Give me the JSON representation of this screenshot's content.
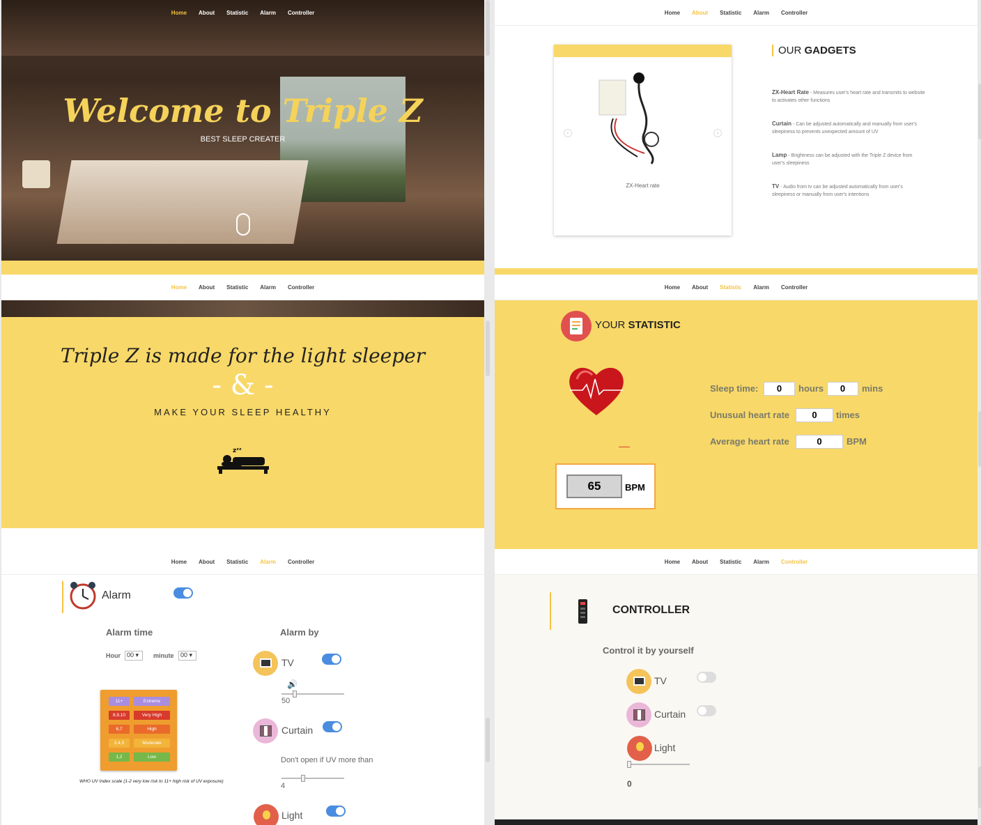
{
  "nav": [
    "Home",
    "About",
    "Statistic",
    "Alarm",
    "Controller"
  ],
  "hero": {
    "title": "Welcome to Triple Z",
    "subtitle": "BEST SLEEP CREATER"
  },
  "gadgets": {
    "heading_light": "OUR",
    "heading_bold": "GADGETS",
    "card_caption": "ZX-Heart rate",
    "items": [
      {
        "name": "ZX-Heart Rate",
        "desc": " - Measures user's heart rate and transmits to website to activates other functions"
      },
      {
        "name": "Curtain",
        "desc": " - Can be adjusted automatically and manually from user's sleepiness to prevents unexpected amount of UV"
      },
      {
        "name": "Lamp",
        "desc": " - Brightness can be adjusted with the Triple Z device from user's sleepiness"
      },
      {
        "name": "TV",
        "desc": " - Audio from tv can be adjusted automatically from user's sleepiness or manually from user's intentions"
      }
    ]
  },
  "intro": {
    "title": "Triple Z is made for the light sleeper",
    "amp": "- & -",
    "subtitle": "MAKE YOUR SLEEP HEALTHY"
  },
  "statistic": {
    "heading_light": "YOUR",
    "heading_bold": "STATISTIC",
    "sleep_label": "Sleep time:",
    "sleep_hours": "0",
    "hours_unit": "hours",
    "sleep_mins": "0",
    "mins_unit": "mins",
    "unusual_label": "Unusual heart rate",
    "unusual_value": "0",
    "unusual_unit": "times",
    "avg_label": "Average heart rate",
    "avg_value": "0",
    "avg_unit": "BPM",
    "bpm_value": "65",
    "bpm_unit": "BPM"
  },
  "alarm": {
    "title": "Alarm",
    "time_heading": "Alarm time",
    "hour_label": "Hour",
    "hour_value": "00",
    "minute_label": "minute",
    "minute_value": "00",
    "by_heading": "Alarm by",
    "tv_label": "TV",
    "tv_volume": "50",
    "curtain_label": "Curtain",
    "uv_text": "Don't open if UV more than",
    "uv_value": "4",
    "light_label": "Light",
    "uv_caption": "WHO UV Index scale (1-2 very low risk  to 11+ high risk of UV exposure)",
    "uv_scale": [
      {
        "range": "11+",
        "level": "Extreme",
        "color": "#a98de0"
      },
      {
        "range": "8,9,10",
        "level": "Very High",
        "color": "#d83a2c"
      },
      {
        "range": "6,7",
        "level": "High",
        "color": "#ea6a2a"
      },
      {
        "range": "3,4,5",
        "level": "Moderate",
        "color": "#f2b43a"
      },
      {
        "range": "1,2",
        "level": "Low",
        "color": "#76b84a"
      }
    ]
  },
  "controller": {
    "title": "CONTROLLER",
    "subtitle": "Control it by yourself",
    "tv_label": "TV",
    "curtain_label": "Curtain",
    "light_label": "Light",
    "light_value": "0"
  },
  "colors": {
    "accent": "#f8d868",
    "active_nav": "#f5c342",
    "toggle_on": "#4a8de0"
  }
}
